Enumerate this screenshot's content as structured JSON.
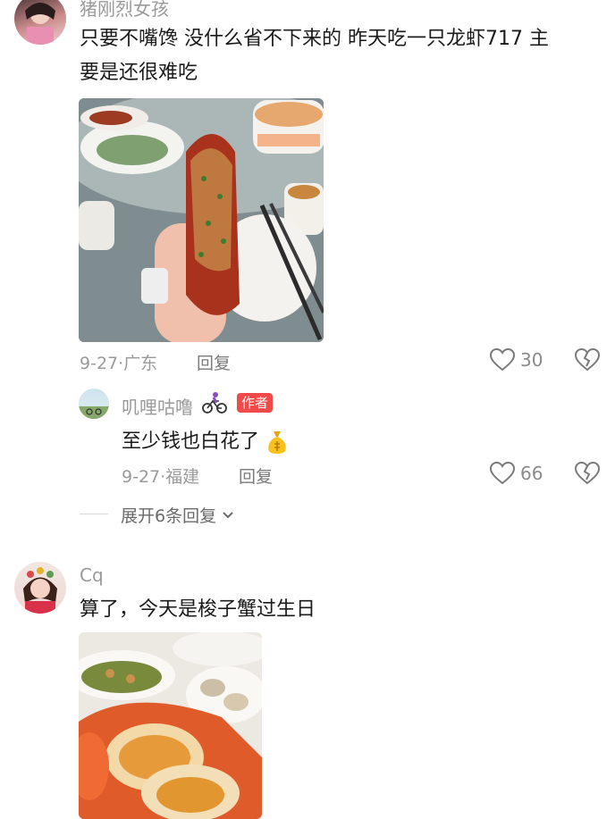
{
  "comments": [
    {
      "username": "猪刚烈女孩",
      "text_line1": "只要不嘴馋 没什么省不下来的 昨天吃一只龙虾717 主",
      "text_line2": "要是还很难吃",
      "date": "9-27·广东",
      "reply_label": "回复",
      "likes": "30"
    },
    {
      "username": "Cq",
      "text": "算了，今天是梭子蟹过生日"
    }
  ],
  "reply": {
    "username": "叽哩咕噜",
    "author_tag": "作者",
    "text": "至少钱也白花了",
    "date": "9-27·福建",
    "reply_label": "回复",
    "likes": "66"
  },
  "expand_replies": "展开6条回复",
  "icons": {
    "like": "heart-outline-icon",
    "dislike": "broken-heart-icon",
    "cyclist": "cyclist-emoji",
    "money_bag": "money-bag-emoji",
    "chevron": "chevron-down-icon"
  },
  "colors": {
    "author_tag": "#f04a4a",
    "meta_gray": "#9a9a9a"
  }
}
